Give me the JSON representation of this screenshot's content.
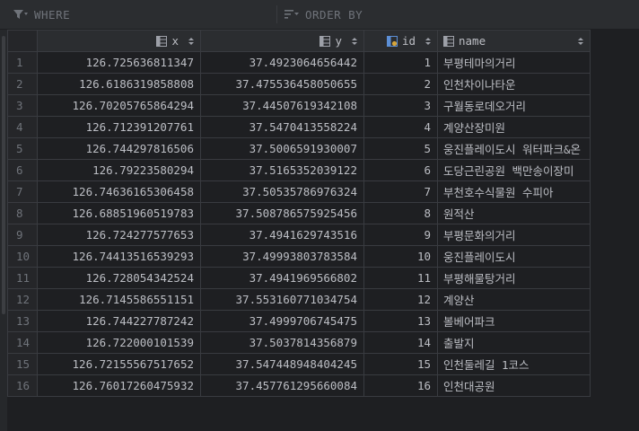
{
  "filter": {
    "where_label": "WHERE",
    "order_by_label": "ORDER BY"
  },
  "columns": [
    {
      "key": "x",
      "label": "x",
      "icon": "column-icon"
    },
    {
      "key": "y",
      "label": "y",
      "icon": "column-icon"
    },
    {
      "key": "id",
      "label": "id",
      "icon": "primary-key-column-icon"
    },
    {
      "key": "name",
      "label": "name",
      "icon": "column-icon"
    }
  ],
  "rows": [
    {
      "n": "1",
      "x": "126.725636811347",
      "y": "37.4923064656442",
      "id": "1",
      "name": "부평테마의거리"
    },
    {
      "n": "2",
      "x": "126.6186319858808",
      "y": "37.475536458050655",
      "id": "2",
      "name": "인천차이나타운"
    },
    {
      "n": "3",
      "x": "126.70205765864294",
      "y": "37.44507619342108",
      "id": "3",
      "name": "구월동로데오거리"
    },
    {
      "n": "4",
      "x": "126.712391207761",
      "y": "37.5470413558224",
      "id": "4",
      "name": "계양산장미원"
    },
    {
      "n": "5",
      "x": "126.744297816506",
      "y": "37.5006591930007",
      "id": "5",
      "name": "웅진플레이도시 워터파크&온"
    },
    {
      "n": "6",
      "x": "126.79223580294",
      "y": "37.5165352039122",
      "id": "6",
      "name": "도당근린공원 백만송이장미"
    },
    {
      "n": "7",
      "x": "126.74636165306458",
      "y": "37.50535786976324",
      "id": "7",
      "name": "부천호수식물원 수피아"
    },
    {
      "n": "8",
      "x": "126.68851960519783",
      "y": "37.508786575925456",
      "id": "8",
      "name": "원적산"
    },
    {
      "n": "9",
      "x": "126.724277577653",
      "y": "37.4941629743516",
      "id": "9",
      "name": "부평문화의거리"
    },
    {
      "n": "10",
      "x": "126.74413516539293",
      "y": "37.49993803783584",
      "id": "10",
      "name": "웅진플레이도시"
    },
    {
      "n": "11",
      "x": "126.728054342524",
      "y": "37.4941969566802",
      "id": "11",
      "name": "부평해물탕거리"
    },
    {
      "n": "12",
      "x": "126.7145586551151",
      "y": "37.553160771034754",
      "id": "12",
      "name": "계양산"
    },
    {
      "n": "13",
      "x": "126.744227787242",
      "y": "37.4999706745475",
      "id": "13",
      "name": "볼베어파크"
    },
    {
      "n": "14",
      "x": "126.722000101539",
      "y": "37.5037814356879",
      "id": "14",
      "name": "출발지"
    },
    {
      "n": "15",
      "x": "126.72155567517652",
      "y": "37.547448948404245",
      "id": "15",
      "name": "인천둘레길 1코스"
    },
    {
      "n": "16",
      "x": "126.76017260475932",
      "y": "37.457761295660084",
      "id": "16",
      "name": "인천대공원"
    }
  ]
}
